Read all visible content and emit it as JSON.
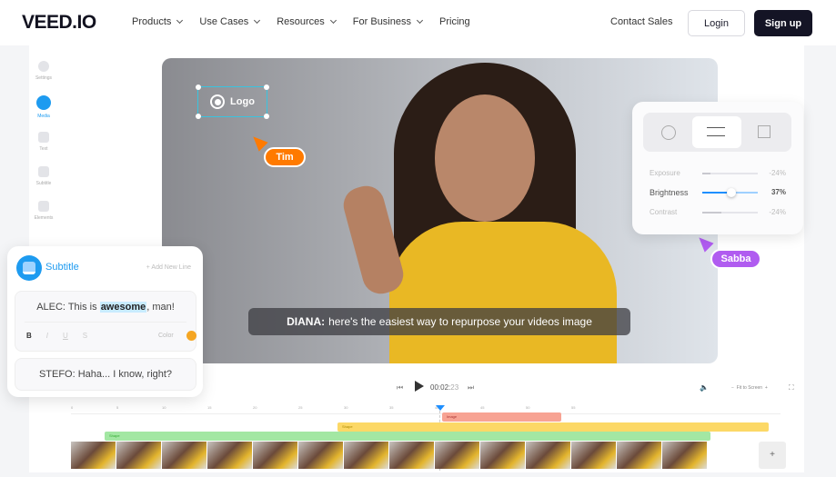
{
  "nav": {
    "brand": "VEED.IO",
    "menu": [
      "Products",
      "Use Cases",
      "Resources",
      "For Business",
      "Pricing"
    ],
    "contact": "Contact Sales",
    "login": "Login",
    "signup": "Sign up"
  },
  "sidebar": [
    {
      "label": "Settings",
      "icon": "gear-icon"
    },
    {
      "label": "Media",
      "icon": "image-icon",
      "active": true
    },
    {
      "label": "Text",
      "icon": "text-icon"
    },
    {
      "label": "Subtitle",
      "icon": "subtitle-icon"
    },
    {
      "label": "Elements",
      "icon": "elements-icon"
    }
  ],
  "video": {
    "logo_label": "Logo",
    "caption_speaker": "DIANA:",
    "caption_text": "here's the easiest way to repurpose your videos image",
    "cursor1": "Tim",
    "cursor2": "Sabba"
  },
  "adjust": {
    "tabs": [
      "color-icon",
      "sliders-icon",
      "crop-icon"
    ],
    "rows": [
      {
        "label": "Exposure",
        "value": "-24%",
        "level": 0.15
      },
      {
        "label": "Brightness",
        "value": "37%",
        "level": 0.5
      },
      {
        "label": "Contrast",
        "value": "-24%",
        "level": 0.35
      }
    ]
  },
  "subtitle": {
    "title": "Subtitle",
    "add": "+ Add New Line",
    "line1_pre": "ALEC: This is ",
    "line1_hl": "awesome",
    "line1_post": ", man!",
    "format": [
      "B",
      "I",
      "U",
      "S"
    ],
    "color_label": "Color",
    "color": "#f5a623",
    "line2": "STEFO: Haha... I know, right?"
  },
  "timeline": {
    "time_main": "00:02:",
    "time_frac": "23",
    "zoom": "Fit to Screen",
    "ticks": [
      "0",
      "5",
      "10",
      "15",
      "20",
      "25",
      "30",
      "35",
      "40",
      "45",
      "50",
      "55"
    ],
    "tracks": [
      {
        "label": "Image",
        "color": "#f7a393"
      },
      {
        "label": "Shape",
        "color": "#fcd866"
      },
      {
        "label": "Shape",
        "color": "#a3e7a3"
      }
    ]
  }
}
